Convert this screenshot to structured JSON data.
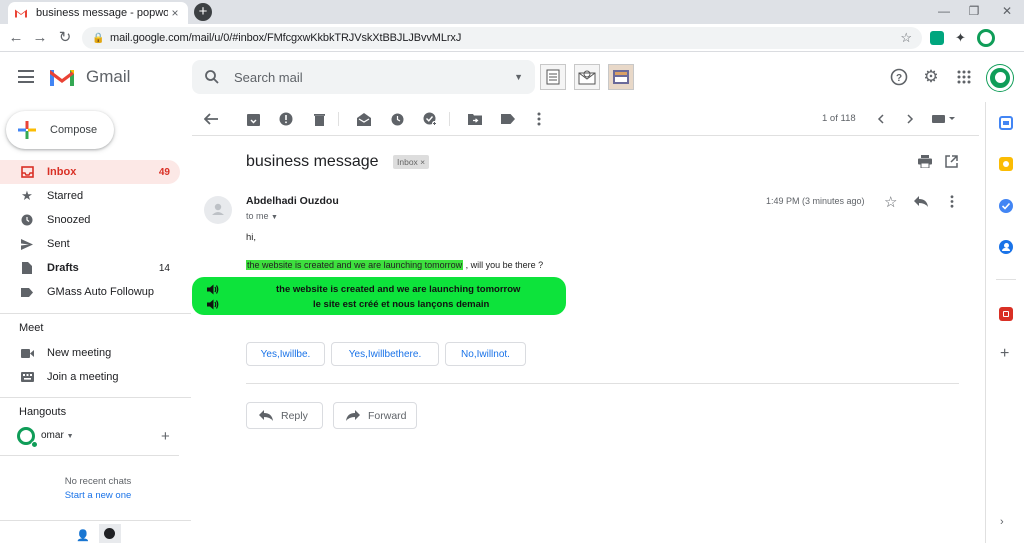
{
  "browser": {
    "tab_title": "business message - popword20",
    "url": "mail.google.com/mail/u/0/#inbox/FMfcgxwKkbkTRJVskXtBBJLJBvvMLrxJ",
    "tab_close": "×",
    "new_tab": "+",
    "win_min": "—",
    "win_max": "❐",
    "win_close": "✕"
  },
  "gmail": {
    "app_name": "Gmail",
    "search_placeholder": "Search mail"
  },
  "sidebar": {
    "compose_label": "Compose",
    "items": [
      {
        "label": "Inbox",
        "count": "49"
      },
      {
        "label": "Starred",
        "count": ""
      },
      {
        "label": "Snoozed",
        "count": ""
      },
      {
        "label": "Sent",
        "count": ""
      },
      {
        "label": "Drafts",
        "count": "14"
      },
      {
        "label": "GMass Auto Followup",
        "count": ""
      }
    ],
    "meet_title": "Meet",
    "meet_items": [
      "New meeting",
      "Join a meeting"
    ],
    "hangouts_title": "Hangouts",
    "hangouts_user": "omar",
    "no_chats": "No recent chats",
    "start_chat": "Start a new one"
  },
  "toolbar": {
    "paging": "1 of 118"
  },
  "message": {
    "subject": "business message",
    "label": "Inbox",
    "sender": "Abdelhadi Ouzdou",
    "to": "to me",
    "time": "1:49 PM (3 minutes ago)",
    "greeting": "hi,",
    "highlight": "the website is created and we are launching tomorrow",
    "rest": " , will you be there ?",
    "translation_en": "the website is created and we are launching tomorrow",
    "translation_fr": "le site est créé et nous lançons demain"
  },
  "smart_replies": [
    "Yes,Iwillbe.",
    "Yes,Iwillbethere.",
    "No,Iwillnot."
  ],
  "actions": {
    "reply": "Reply",
    "forward": "Forward"
  },
  "colors": {
    "translate_bg": "#0de33b",
    "highlight_bg": "#3ee03e",
    "inbox_active": "#d93025",
    "link": "#1a73e8"
  }
}
